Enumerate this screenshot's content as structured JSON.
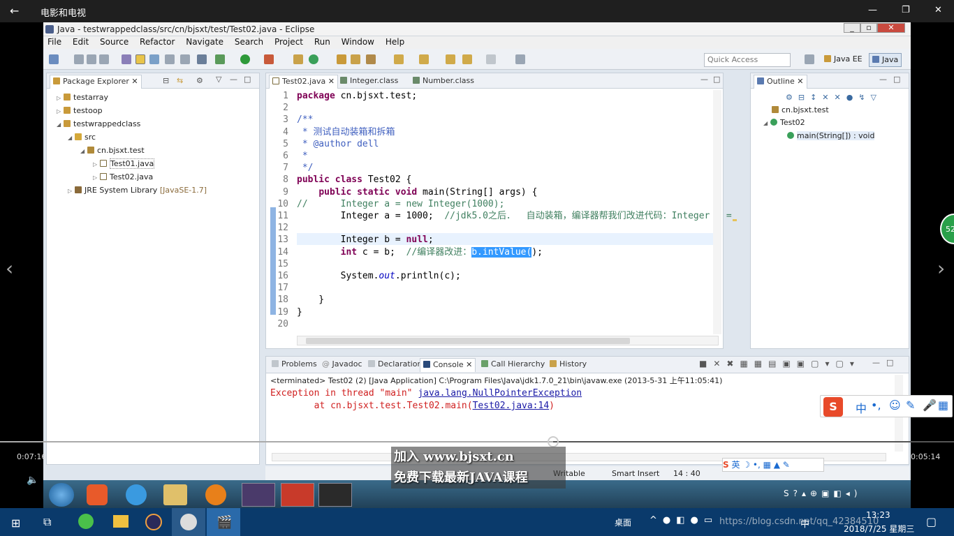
{
  "app_bar": {
    "title": "电影和电视"
  },
  "player": {
    "time_elapsed": "0:07:16",
    "time_remaining": "0:05:14",
    "progress": 0.58
  },
  "eclipse": {
    "window_title": "Java - testwrappedclass/src/cn/bjsxt/test/Test02.java - Eclipse",
    "menu": [
      "File",
      "Edit",
      "Source",
      "Refactor",
      "Navigate",
      "Search",
      "Project",
      "Run",
      "Window",
      "Help"
    ],
    "quick_access": "Quick Access",
    "perspectives": [
      "Java EE",
      "Java"
    ],
    "package_explorer": {
      "title": "Package Explorer",
      "items": [
        {
          "label": "testarray",
          "level": 0
        },
        {
          "label": "testoop",
          "level": 0
        },
        {
          "label": "testwrappedclass",
          "level": 0
        },
        {
          "label": "src",
          "level": 1
        },
        {
          "label": "cn.bjsxt.test",
          "level": 2
        },
        {
          "label": "Test01.java",
          "level": 3
        },
        {
          "label": "Test02.java",
          "level": 3
        },
        {
          "label": "JRE System Library",
          "extra": "[JavaSE-1.7]",
          "level": 1
        }
      ]
    },
    "editor_tabs": [
      "Test02.java",
      "Integer.class",
      "Number.class"
    ],
    "code_lines": [
      {
        "n": "1",
        "html": "<span class='kw'>package</span> cn.bjsxt.test;"
      },
      {
        "n": "2",
        "html": ""
      },
      {
        "n": "3",
        "html": "<span class='jd'>/**</span>"
      },
      {
        "n": "4",
        "html": "<span class='jd'> * 测试自动装箱和拆箱</span>"
      },
      {
        "n": "5",
        "html": "<span class='jd'> * @author dell</span>"
      },
      {
        "n": "6",
        "html": "<span class='jd'> *</span>"
      },
      {
        "n": "7",
        "html": "<span class='jd'> */</span>"
      },
      {
        "n": "8",
        "html": "<span class='kw'>public class</span> Test02 {"
      },
      {
        "n": "9",
        "html": "    <span class='kw'>public static void</span> main(String[] args) {"
      },
      {
        "n": "10",
        "html": "<span class='cm'>//      Integer a = new Integer(1000);</span>"
      },
      {
        "n": "11",
        "html": "        Integer a = 1000;  <span class='cm'>//jdk5.0之后．  自动装箱，编译器帮我们改进代码：Integer a =</span>"
      },
      {
        "n": "12",
        "html": ""
      },
      {
        "n": "13",
        "html": "        Integer b = <span class='kw'>null</span>;"
      },
      {
        "n": "14",
        "html": "        <span class='kw'>int</span> c = b;  <span class='cm'>//编译器改进：</span><span class='sel'>b.intValue(</span>);"
      },
      {
        "n": "15",
        "html": ""
      },
      {
        "n": "16",
        "html": "        System.<span class='fld'>out</span>.println(c);"
      },
      {
        "n": "17",
        "html": ""
      },
      {
        "n": "18",
        "html": "    }"
      },
      {
        "n": "19",
        "html": "}"
      },
      {
        "n": "20",
        "html": ""
      }
    ],
    "outline": {
      "title": "Outline",
      "items": [
        "cn.bjsxt.test",
        "Test02",
        "main(String[]) : void"
      ]
    },
    "bottom_tabs": [
      "Problems",
      "Javadoc",
      "Declaration",
      "Console",
      "Call Hierarchy",
      "History"
    ],
    "console": {
      "header": "<terminated> Test02 (2) [Java Application] C:\\Program Files\\Java\\jdk1.7.0_21\\bin\\javaw.exe (2013-5-31 上午11:05:41)",
      "line1_prefix": "Exception in thread \"main\" ",
      "line1_link": "java.lang.NullPointerException",
      "line2_prefix": "        at cn.bjsxt.test.Test02.main(",
      "line2_link": "Test02.java:14",
      "line2_suffix": ")"
    },
    "status": {
      "writable": "Writable",
      "mode": "Smart Insert",
      "pos": "14 : 40"
    }
  },
  "watermark": {
    "line1": "加入 www.bjsxt.cn",
    "line2": "免费下载最新JAVA课程"
  },
  "ime": {
    "lang": "中",
    "mini": "英"
  },
  "badge": "52",
  "taskbar": {
    "desktop": "桌面",
    "time": "13:23",
    "date": "2018/7/25 星期三",
    "tray_text": "中",
    "url_fragment": "https://blog.csdn.net/qq_42384510"
  }
}
